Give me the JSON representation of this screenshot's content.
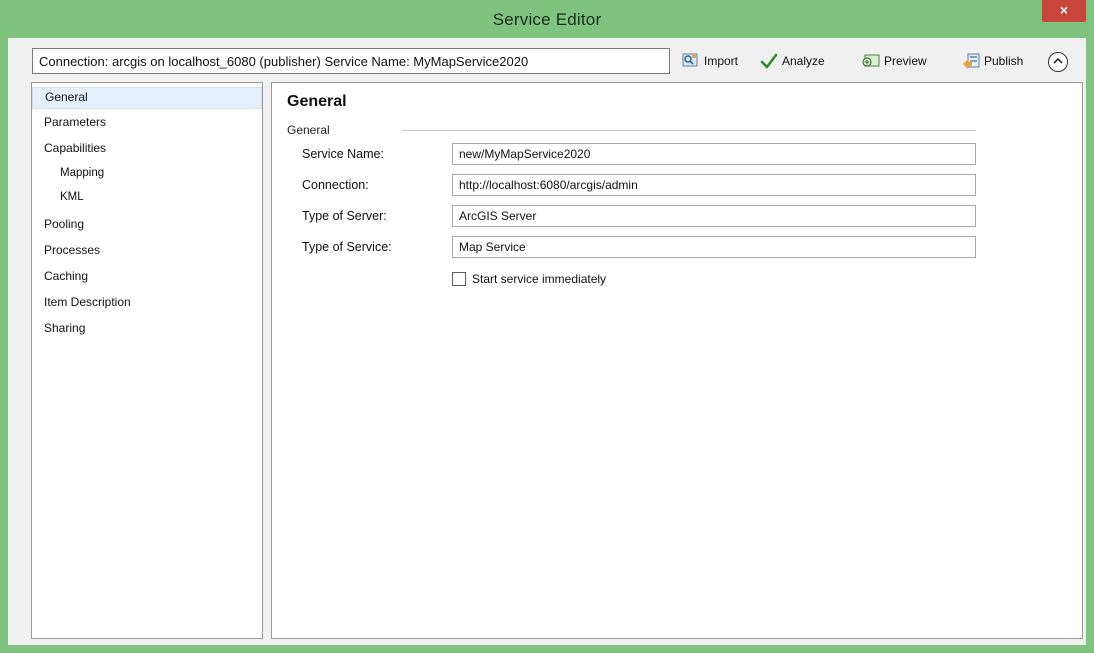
{
  "window": {
    "title": "Service Editor",
    "close_glyph": "×"
  },
  "toolbar": {
    "connection_text": "Connection: arcgis on localhost_6080 (publisher)  Service Name: MyMapService2020",
    "buttons": [
      {
        "label": "Import",
        "icon": "import-icon"
      },
      {
        "label": "Analyze",
        "icon": "checkmark-icon"
      },
      {
        "label": "Preview",
        "icon": "preview-icon"
      },
      {
        "label": "Publish",
        "icon": "publish-icon"
      }
    ],
    "collapse_glyph": "⌃"
  },
  "nav": {
    "items": [
      {
        "label": "General",
        "selected": true,
        "sub": false
      },
      {
        "label": "Parameters",
        "selected": false,
        "sub": false
      },
      {
        "label": "Capabilities",
        "selected": false,
        "sub": false
      },
      {
        "label": "Mapping",
        "selected": false,
        "sub": true
      },
      {
        "label": "KML",
        "selected": false,
        "sub": true
      },
      {
        "label": "Pooling",
        "selected": false,
        "sub": false
      },
      {
        "label": "Processes",
        "selected": false,
        "sub": false
      },
      {
        "label": "Caching",
        "selected": false,
        "sub": false
      },
      {
        "label": "Item Description",
        "selected": false,
        "sub": false
      },
      {
        "label": "Sharing",
        "selected": false,
        "sub": false
      }
    ]
  },
  "panel": {
    "title": "General",
    "group_label": "General",
    "fields": [
      {
        "label": "Service Name:",
        "value": "new/MyMapService2020"
      },
      {
        "label": "Connection:",
        "value": "http://localhost:6080/arcgis/admin"
      },
      {
        "label": "Type of Server:",
        "value": "ArcGIS Server"
      },
      {
        "label": "Type of Service:",
        "value": "Map Service"
      }
    ],
    "start_checkbox": {
      "label": "Start service immediately",
      "checked": false
    }
  },
  "colors": {
    "frame": "#7ec47e",
    "close": "#c9463d",
    "selected_nav": "#e6f0fa"
  }
}
